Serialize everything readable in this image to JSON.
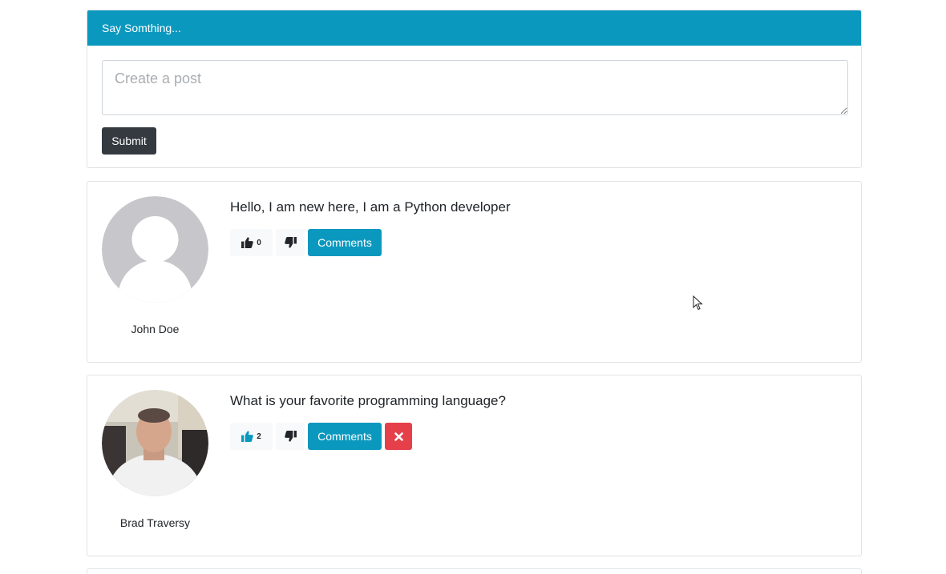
{
  "post_form": {
    "header": "Say Somthing...",
    "placeholder": "Create a post",
    "submit_label": "Submit"
  },
  "posts": [
    {
      "author": "John Doe",
      "text": "Hello, I am new here, I am a Python developer",
      "like_count": "0",
      "comments_label": "Comments",
      "liked": false,
      "can_delete": false,
      "avatar": "default-avatar"
    },
    {
      "author": "Brad Traversy",
      "text": "What is your favorite programming language?",
      "like_count": "2",
      "comments_label": "Comments",
      "liked": true,
      "can_delete": true,
      "avatar": "user-photo"
    }
  ],
  "icons": {
    "like": "thumbs-up-icon",
    "unlike": "thumbs-down-icon",
    "delete": "times-icon"
  },
  "colors": {
    "primary": "#0b98bf",
    "dark": "#343a40",
    "danger": "#e53f4a",
    "light": "#f8f9fa",
    "liked_icon": "#0b98bf"
  }
}
